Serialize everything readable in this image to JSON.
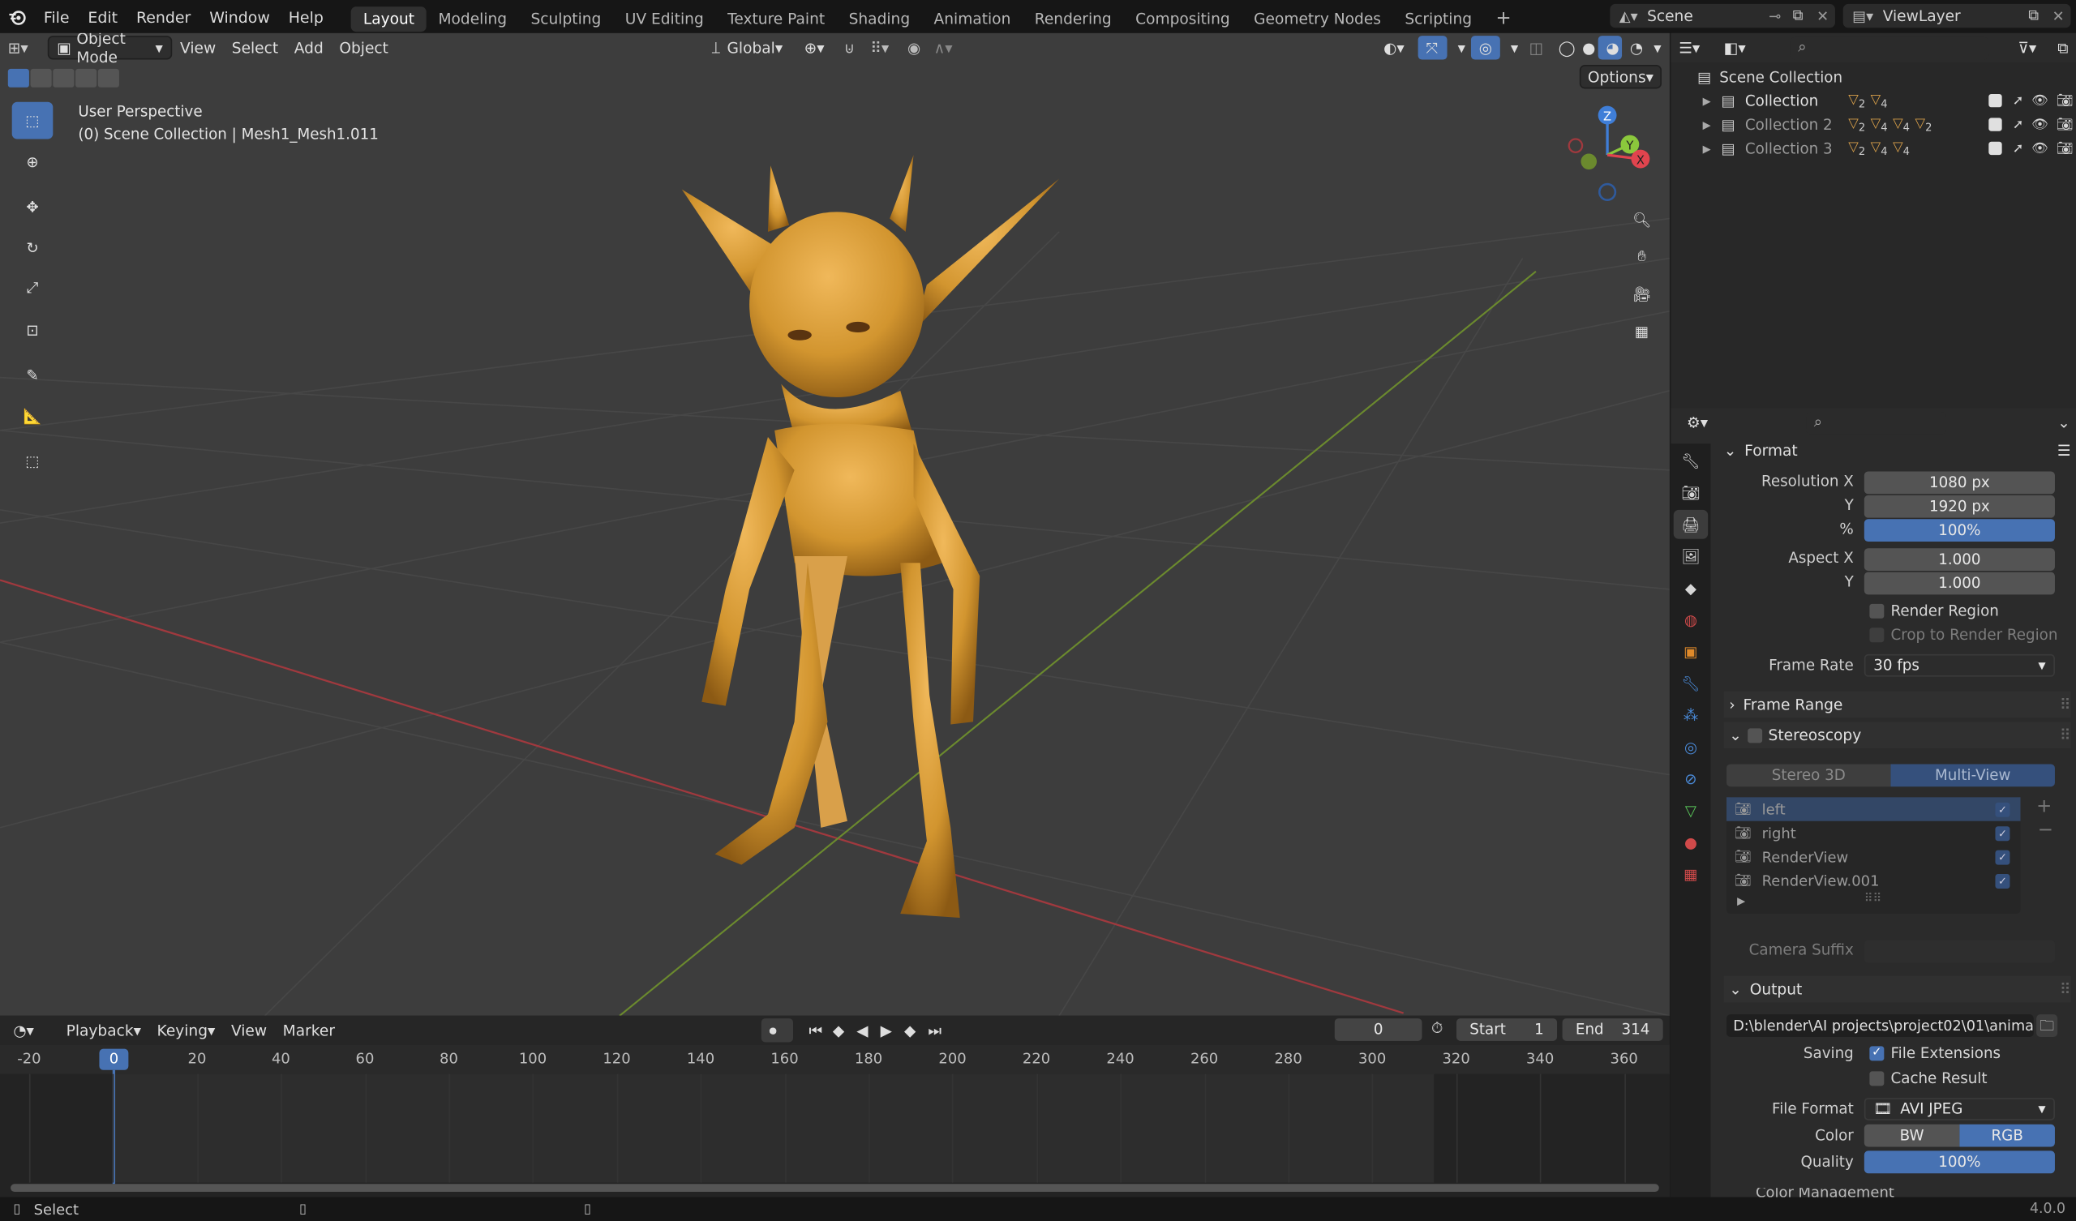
{
  "topbar": {
    "menus": [
      "File",
      "Edit",
      "Render",
      "Window",
      "Help"
    ],
    "workspaces": [
      "Layout",
      "Modeling",
      "Sculpting",
      "UV Editing",
      "Texture Paint",
      "Shading",
      "Animation",
      "Rendering",
      "Compositing",
      "Geometry Nodes",
      "Scripting"
    ],
    "active_workspace": "Layout",
    "add_tab": "+",
    "scene": "Scene",
    "view_layer": "ViewLayer"
  },
  "viewport": {
    "mode": "Object Mode",
    "menus": [
      "View",
      "Select",
      "Add",
      "Object"
    ],
    "orientation": "Global",
    "options": "Options",
    "perspective": "User Perspective",
    "context": "(0) Scene Collection | Mesh1_Mesh1.011",
    "gizmo_axes": {
      "z": "Z",
      "y": "Y",
      "x": "X"
    }
  },
  "timeline": {
    "menus": [
      "Playback",
      "Keying",
      "View",
      "Marker"
    ],
    "current_frame": "0",
    "start_label": "Start",
    "start": "1",
    "end_label": "End",
    "end": "314",
    "ruler": [
      "-20",
      "0",
      "20",
      "40",
      "60",
      "80",
      "100",
      "120",
      "140",
      "160",
      "180",
      "200",
      "220",
      "240",
      "260",
      "280",
      "300",
      "320",
      "340",
      "360"
    ]
  },
  "outliner": {
    "root": "Scene Collection",
    "collections": [
      {
        "name": "Collection",
        "counts": [
          "2",
          "4"
        ]
      },
      {
        "name": "Collection 2",
        "counts": [
          "2",
          "4",
          "4",
          "2"
        ]
      },
      {
        "name": "Collection 3",
        "counts": [
          "2",
          "4",
          "4"
        ]
      }
    ]
  },
  "properties": {
    "format": {
      "title": "Format",
      "resolution_x_label": "Resolution X",
      "resolution_x": "1080 px",
      "y_label": "Y",
      "resolution_y": "1920 px",
      "pct_label": "%",
      "resolution_pct": "100%",
      "aspect_x_label": "Aspect X",
      "aspect_x": "1.000",
      "aspect_y_label": "Y",
      "aspect_y": "1.000",
      "render_region": "Render Region",
      "crop_region": "Crop to Render Region",
      "frame_rate_label": "Frame Rate",
      "frame_rate": "30 fps"
    },
    "frame_range": {
      "title": "Frame Range"
    },
    "stereoscopy": {
      "title": "Stereoscopy",
      "tab_stereo": "Stereo 3D",
      "tab_multi": "Multi-View",
      "views": [
        "left",
        "right",
        "RenderView",
        "RenderView.001"
      ],
      "camera_suffix_label": "Camera Suffix"
    },
    "output": {
      "title": "Output",
      "path": "D:\\blender\\AI projects\\project02\\01\\anima...",
      "saving_label": "Saving",
      "file_extensions": "File Extensions",
      "cache_result": "Cache Result",
      "file_format_label": "File Format",
      "file_format": "AVI JPEG",
      "color_label": "Color",
      "color_bw": "BW",
      "color_rgb": "RGB",
      "quality_label": "Quality",
      "quality": "100%",
      "color_management": "Color Management"
    }
  },
  "status": {
    "select": "Select",
    "version": "4.0.0"
  },
  "colors": {
    "accent": "#4772b3",
    "x_axis": "#e0444e",
    "y_axis": "#8bc83c",
    "z_axis": "#3f7ed8",
    "model": "#d99a3a"
  }
}
